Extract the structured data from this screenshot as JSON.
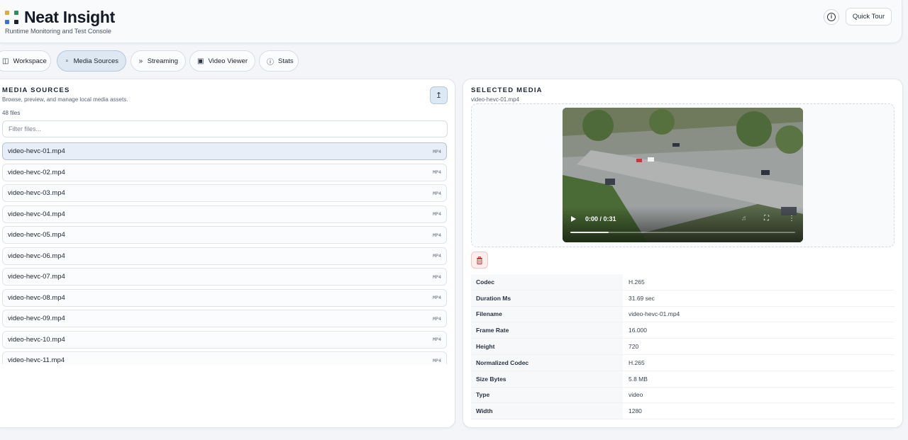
{
  "header": {
    "title": "Neat Insight",
    "subtitle": "Runtime Monitoring and Test Console",
    "tour_label": "Quick Tour",
    "logo_colors": [
      "#e2a93b",
      "#2f8f5b",
      "#3b6fd6",
      "#1a2230"
    ]
  },
  "tabs": [
    {
      "label": "Workspace",
      "icon": "workspace-icon",
      "active": false
    },
    {
      "label": "Media Sources",
      "icon": "folder-icon",
      "active": true
    },
    {
      "label": "Streaming",
      "icon": "chevrons-right-icon",
      "active": false
    },
    {
      "label": "Video Viewer",
      "icon": "tv-icon",
      "active": false
    },
    {
      "label": "Stats",
      "icon": "info-icon",
      "active": false
    }
  ],
  "media_sources": {
    "title": "MEDIA SOURCES",
    "subtitle": "Browse, preview, and manage local media assets.",
    "count": "48 files",
    "filter_placeholder": "Filter files...",
    "files": [
      {
        "name": "video-hevc-01.mp4",
        "type": "MP4",
        "selected": true
      },
      {
        "name": "video-hevc-02.mp4",
        "type": "MP4"
      },
      {
        "name": "video-hevc-03.mp4",
        "type": "MP4"
      },
      {
        "name": "video-hevc-04.mp4",
        "type": "MP4"
      },
      {
        "name": "video-hevc-05.mp4",
        "type": "MP4"
      },
      {
        "name": "video-hevc-06.mp4",
        "type": "MP4"
      },
      {
        "name": "video-hevc-07.mp4",
        "type": "MP4"
      },
      {
        "name": "video-hevc-08.mp4",
        "type": "MP4"
      },
      {
        "name": "video-hevc-09.mp4",
        "type": "MP4"
      },
      {
        "name": "video-hevc-10.mp4",
        "type": "MP4"
      },
      {
        "name": "video-hevc-11.mp4",
        "type": "MP4"
      }
    ]
  },
  "selected_media": {
    "title": "SELECTED MEDIA",
    "filename": "video-hevc-01.mp4",
    "player": {
      "time": "0:00 / 0:31",
      "progress": 0.17
    },
    "metadata": [
      {
        "key": "Codec",
        "value": "H.265"
      },
      {
        "key": "Duration Ms",
        "value": "31.69 sec"
      },
      {
        "key": "Filename",
        "value": "video-hevc-01.mp4"
      },
      {
        "key": "Frame Rate",
        "value": "16.000"
      },
      {
        "key": "Height",
        "value": "720"
      },
      {
        "key": "Normalized Codec",
        "value": "H.265"
      },
      {
        "key": "Size Bytes",
        "value": "5.8 MB"
      },
      {
        "key": "Type",
        "value": "video"
      },
      {
        "key": "Width",
        "value": "1280"
      }
    ]
  }
}
